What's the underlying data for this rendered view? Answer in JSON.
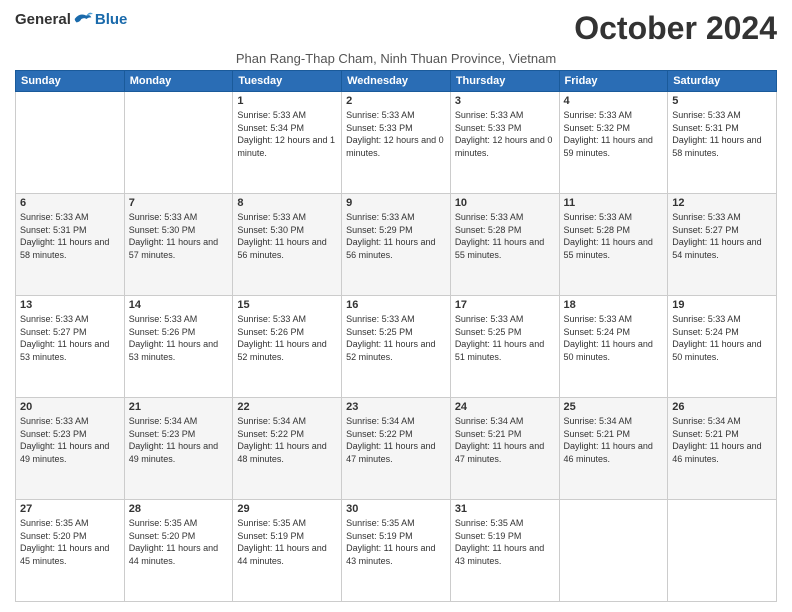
{
  "logo": {
    "general": "General",
    "blue": "Blue"
  },
  "title": "October 2024",
  "subtitle": "Phan Rang-Thap Cham, Ninh Thuan Province, Vietnam",
  "days": [
    "Sunday",
    "Monday",
    "Tuesday",
    "Wednesday",
    "Thursday",
    "Friday",
    "Saturday"
  ],
  "weeks": [
    [
      {
        "day": null,
        "text": null
      },
      {
        "day": null,
        "text": null
      },
      {
        "day": "1",
        "sunrise": "5:33 AM",
        "sunset": "5:34 PM",
        "daylight": "12 hours and 1 minute."
      },
      {
        "day": "2",
        "sunrise": "5:33 AM",
        "sunset": "5:33 PM",
        "daylight": "12 hours and 0 minutes."
      },
      {
        "day": "3",
        "sunrise": "5:33 AM",
        "sunset": "5:33 PM",
        "daylight": "12 hours and 0 minutes."
      },
      {
        "day": "4",
        "sunrise": "5:33 AM",
        "sunset": "5:32 PM",
        "daylight": "11 hours and 59 minutes."
      },
      {
        "day": "5",
        "sunrise": "5:33 AM",
        "sunset": "5:31 PM",
        "daylight": "11 hours and 58 minutes."
      }
    ],
    [
      {
        "day": "6",
        "sunrise": "5:33 AM",
        "sunset": "5:31 PM",
        "daylight": "11 hours and 58 minutes."
      },
      {
        "day": "7",
        "sunrise": "5:33 AM",
        "sunset": "5:30 PM",
        "daylight": "11 hours and 57 minutes."
      },
      {
        "day": "8",
        "sunrise": "5:33 AM",
        "sunset": "5:30 PM",
        "daylight": "11 hours and 56 minutes."
      },
      {
        "day": "9",
        "sunrise": "5:33 AM",
        "sunset": "5:29 PM",
        "daylight": "11 hours and 56 minutes."
      },
      {
        "day": "10",
        "sunrise": "5:33 AM",
        "sunset": "5:28 PM",
        "daylight": "11 hours and 55 minutes."
      },
      {
        "day": "11",
        "sunrise": "5:33 AM",
        "sunset": "5:28 PM",
        "daylight": "11 hours and 55 minutes."
      },
      {
        "day": "12",
        "sunrise": "5:33 AM",
        "sunset": "5:27 PM",
        "daylight": "11 hours and 54 minutes."
      }
    ],
    [
      {
        "day": "13",
        "sunrise": "5:33 AM",
        "sunset": "5:27 PM",
        "daylight": "11 hours and 53 minutes."
      },
      {
        "day": "14",
        "sunrise": "5:33 AM",
        "sunset": "5:26 PM",
        "daylight": "11 hours and 53 minutes."
      },
      {
        "day": "15",
        "sunrise": "5:33 AM",
        "sunset": "5:26 PM",
        "daylight": "11 hours and 52 minutes."
      },
      {
        "day": "16",
        "sunrise": "5:33 AM",
        "sunset": "5:25 PM",
        "daylight": "11 hours and 52 minutes."
      },
      {
        "day": "17",
        "sunrise": "5:33 AM",
        "sunset": "5:25 PM",
        "daylight": "11 hours and 51 minutes."
      },
      {
        "day": "18",
        "sunrise": "5:33 AM",
        "sunset": "5:24 PM",
        "daylight": "11 hours and 50 minutes."
      },
      {
        "day": "19",
        "sunrise": "5:33 AM",
        "sunset": "5:24 PM",
        "daylight": "11 hours and 50 minutes."
      }
    ],
    [
      {
        "day": "20",
        "sunrise": "5:33 AM",
        "sunset": "5:23 PM",
        "daylight": "11 hours and 49 minutes."
      },
      {
        "day": "21",
        "sunrise": "5:34 AM",
        "sunset": "5:23 PM",
        "daylight": "11 hours and 49 minutes."
      },
      {
        "day": "22",
        "sunrise": "5:34 AM",
        "sunset": "5:22 PM",
        "daylight": "11 hours and 48 minutes."
      },
      {
        "day": "23",
        "sunrise": "5:34 AM",
        "sunset": "5:22 PM",
        "daylight": "11 hours and 47 minutes."
      },
      {
        "day": "24",
        "sunrise": "5:34 AM",
        "sunset": "5:21 PM",
        "daylight": "11 hours and 47 minutes."
      },
      {
        "day": "25",
        "sunrise": "5:34 AM",
        "sunset": "5:21 PM",
        "daylight": "11 hours and 46 minutes."
      },
      {
        "day": "26",
        "sunrise": "5:34 AM",
        "sunset": "5:21 PM",
        "daylight": "11 hours and 46 minutes."
      }
    ],
    [
      {
        "day": "27",
        "sunrise": "5:35 AM",
        "sunset": "5:20 PM",
        "daylight": "11 hours and 45 minutes."
      },
      {
        "day": "28",
        "sunrise": "5:35 AM",
        "sunset": "5:20 PM",
        "daylight": "11 hours and 44 minutes."
      },
      {
        "day": "29",
        "sunrise": "5:35 AM",
        "sunset": "5:19 PM",
        "daylight": "11 hours and 44 minutes."
      },
      {
        "day": "30",
        "sunrise": "5:35 AM",
        "sunset": "5:19 PM",
        "daylight": "11 hours and 43 minutes."
      },
      {
        "day": "31",
        "sunrise": "5:35 AM",
        "sunset": "5:19 PM",
        "daylight": "11 hours and 43 minutes."
      },
      {
        "day": null,
        "text": null
      },
      {
        "day": null,
        "text": null
      }
    ]
  ]
}
